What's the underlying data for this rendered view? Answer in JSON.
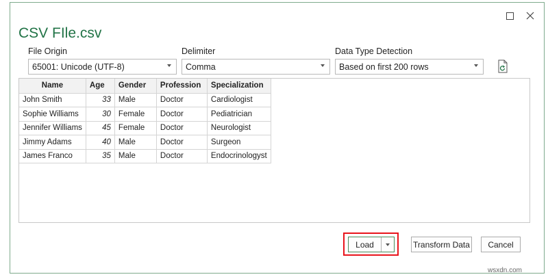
{
  "dialog": {
    "title": "CSV FIle.csv"
  },
  "file_origin": {
    "label": "File Origin",
    "value": "65001: Unicode (UTF-8)"
  },
  "delimiter": {
    "label": "Delimiter",
    "value": "Comma"
  },
  "detection": {
    "label": "Data Type Detection",
    "value": "Based on first 200 rows"
  },
  "table": {
    "headers": [
      "Name",
      "Age",
      "Gender",
      "Profession",
      "Specialization"
    ],
    "rows": [
      [
        "John Smith",
        "33",
        "Male",
        "Doctor",
        "Cardiologist"
      ],
      [
        "Sophie Williams",
        "30",
        "Female",
        "Doctor",
        "Pediatrician"
      ],
      [
        "Jennifer Williams",
        "45",
        "Female",
        "Doctor",
        "Neurologist"
      ],
      [
        "Jimmy Adams",
        "40",
        "Male",
        "Doctor",
        "Surgeon"
      ],
      [
        "James Franco",
        "35",
        "Male",
        "Doctor",
        "Endocrinologyst"
      ]
    ]
  },
  "buttons": {
    "load": "Load",
    "transform": "Transform Data",
    "cancel": "Cancel"
  },
  "watermark": "wsxdn.com",
  "colors": {
    "title": "#217346",
    "highlight": "#e8141b"
  },
  "icons": {
    "maximize": "maximize-icon",
    "close": "close-icon",
    "refresh": "refresh-file-icon",
    "dropdown": "chevron-down-icon"
  }
}
